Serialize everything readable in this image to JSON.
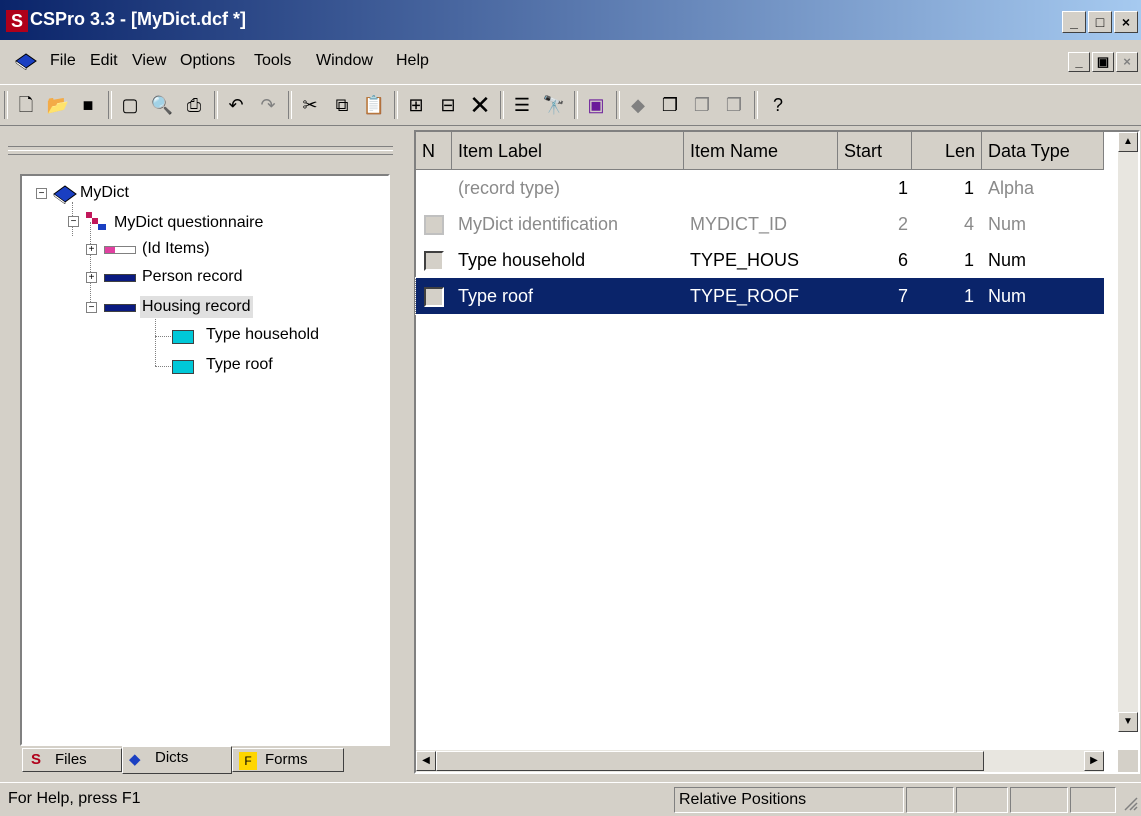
{
  "window": {
    "title": "CSPro 3.3 - [MyDict.dcf *]",
    "app_icon_letter": "S",
    "title_color": "#0a246a"
  },
  "menu": {
    "items": [
      "File",
      "Edit",
      "View",
      "Options",
      "Tools",
      "Window",
      "Help"
    ]
  },
  "toolbar": {
    "icons": [
      "new-icon",
      "open-icon",
      "save-icon",
      "page-icon",
      "print-preview-icon",
      "print-icon",
      "undo-icon",
      "redo-icon",
      "cut-icon",
      "copy-icon",
      "paste-icon",
      "add-item-icon",
      "insert-item-icon",
      "delete-icon",
      "properties-icon",
      "find-icon",
      "layout-icon",
      "dictionary-icon",
      "forms-icon",
      "forms2-icon",
      "forms3-icon",
      "help-icon"
    ]
  },
  "tree": {
    "root": "MyDict",
    "level": "MyDict questionnaire",
    "records": [
      "(Id Items)",
      "Person record",
      "Housing record"
    ],
    "housing_items": [
      "Type household",
      "Type roof"
    ]
  },
  "tabs": [
    "Files",
    "Dicts",
    "Forms"
  ],
  "grid": {
    "headers": [
      "N",
      "Item Label",
      "Item Name",
      "Start",
      "Len",
      "Data Type"
    ],
    "rows": [
      {
        "label": "(record type)",
        "name": "",
        "start": "1",
        "len": "1",
        "type": "Alpha"
      },
      {
        "label": "MyDict identification",
        "name": "MYDICT_ID",
        "start": "2",
        "len": "4",
        "type": "Num"
      },
      {
        "label": "Type household",
        "name": "TYPE_HOUS",
        "start": "6",
        "len": "1",
        "type": "Num"
      },
      {
        "label": "Type roof",
        "name": "TYPE_ROOF",
        "start": "7",
        "len": "1",
        "type": "Num"
      }
    ],
    "selected_color": "#0a246a"
  },
  "status": {
    "help": "For Help, press F1",
    "mode": "Relative Positions"
  }
}
